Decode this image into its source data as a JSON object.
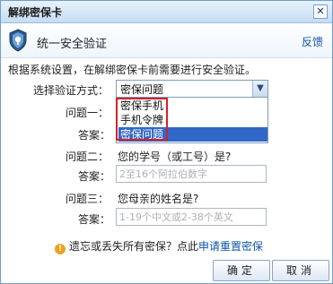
{
  "window": {
    "title": "解绑密保卡",
    "close_glyph": "✕"
  },
  "header": {
    "title": "统一安全验证",
    "feedback_link": "反馈",
    "icon": "shield-icon"
  },
  "description": "根据系统设置，在解绑密保卡前需要进行安全验证。",
  "method": {
    "label": "选择验证方式：",
    "selected": "密保问题",
    "options": [
      "密保手机",
      "手机令牌",
      "密保问题"
    ]
  },
  "question1": {
    "label": "问题一：",
    "answer_label": "答案："
  },
  "question2": {
    "label": "问题二：",
    "text": "您的学号（或工号）是?",
    "answer_label": "答案：",
    "placeholder": "2至16个阿拉伯数字"
  },
  "question3": {
    "label": "问题三：",
    "text": "您母亲的姓名是?",
    "answer_label": "答案：",
    "placeholder": "1-19个中文或2-38个英文"
  },
  "hint": {
    "text": "遗忘或丢失所有密保？点此",
    "link": "申请重置密保",
    "icon": "info-icon",
    "icon_glyph": "!"
  },
  "buttons": {
    "ok": "确定",
    "cancel": "取消"
  },
  "colors": {
    "accent": "#3168c8",
    "link": "#1155aa",
    "highlight_border": "#d4202a"
  }
}
